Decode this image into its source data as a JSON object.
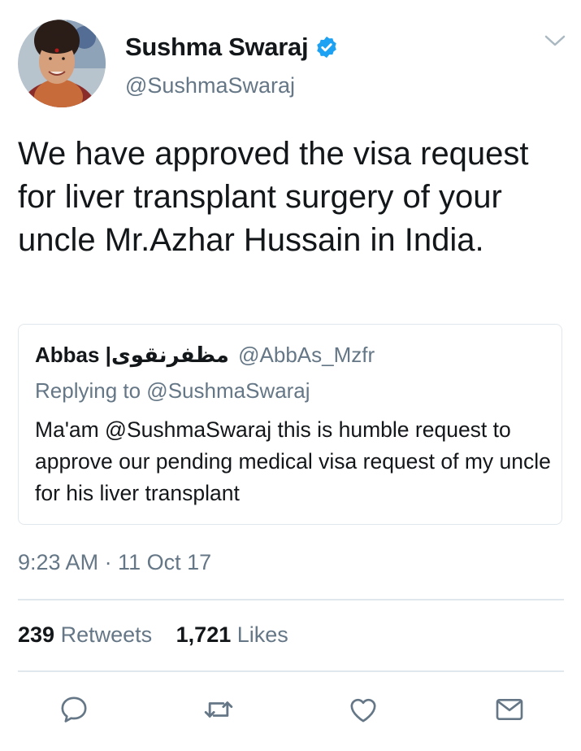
{
  "author": {
    "name": "Sushma Swaraj",
    "handle": "@SushmaSwaraj",
    "verified": true
  },
  "tweet": {
    "text": "We have approved the visa request for liver transplant surgery of your uncle Mr.Azhar Hussain in India.",
    "timestamp": "9:23 AM · 11 Oct 17"
  },
  "quoted": {
    "name": "Abbas |مظفرنقوی",
    "handle": "@AbbAs_Mzfr",
    "replying_to": "Replying to @SushmaSwaraj",
    "text": "Ma'am @SushmaSwaraj this is humble request to approve our pending medical visa request of my uncle for his liver transplant"
  },
  "stats": {
    "retweets_count": "239",
    "retweets_label": "Retweets",
    "likes_count": "1,721",
    "likes_label": "Likes"
  },
  "icons": {
    "reply": "reply-icon",
    "retweet": "retweet-icon",
    "like": "heart-icon",
    "dm": "envelope-icon",
    "caret": "chevron-down-icon",
    "verified": "verified-badge-icon"
  },
  "colors": {
    "verified_blue": "#1da1f2",
    "muted": "#657786",
    "text": "#14171a",
    "border": "#e1e8ed"
  }
}
